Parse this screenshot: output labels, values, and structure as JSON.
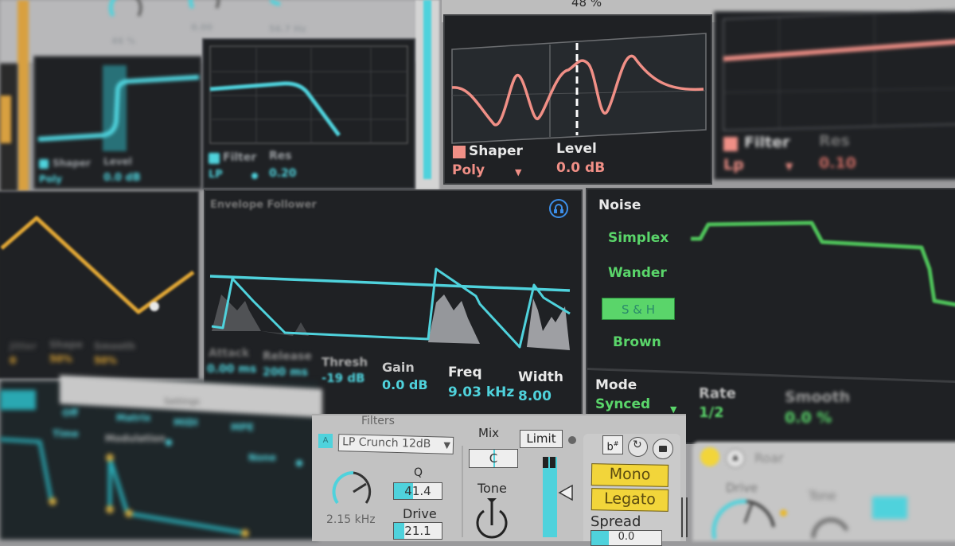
{
  "top_strip": {
    "knob_values": [
      "46 %",
      "0.00",
      "56.7 Hz"
    ],
    "right_value": "48 %"
  },
  "panel_a": {
    "shaper_toggle": "Shaper",
    "shaper_mode": "Poly",
    "level_label": "Level",
    "level_value": "0.0 dB"
  },
  "panel_a_filter": {
    "filter_label": "Filter",
    "filter_type": "LP",
    "res_label": "Res",
    "res_value": "0.20"
  },
  "shaper": {
    "toggle_label": "Shaper",
    "mode_value": "Poly",
    "level_label": "Level",
    "level_value": "0.0 dB",
    "color": "#f08f86"
  },
  "filter_b": {
    "label": "Filter",
    "type_value": "Lp",
    "res_label": "Res",
    "res_value": "0.10"
  },
  "lfo": {
    "params": [
      {
        "label": "Jitter",
        "value": "0"
      },
      {
        "label": "Shape",
        "value": "50%"
      },
      {
        "label": "Smooth",
        "value": "50%"
      }
    ],
    "color": "#e0a635"
  },
  "envelope_follower": {
    "title": "Envelope Follower",
    "params": [
      {
        "label": "Attack",
        "value": "0.00 ms"
      },
      {
        "label": "Release",
        "value": "200 ms"
      },
      {
        "label": "Thresh",
        "value": "-19 dB"
      },
      {
        "label": "Gain",
        "value": "0.0 dB"
      },
      {
        "label": "Freq",
        "value": "9.03 kHz"
      },
      {
        "label": "Width",
        "value": "8.00"
      }
    ],
    "color": "#4fd2dc"
  },
  "noise": {
    "title": "Noise",
    "types": [
      "Simplex",
      "Wander",
      "S & H",
      "Brown"
    ],
    "selected": "S & H",
    "mode_label": "Mode",
    "mode_value": "Synced",
    "rate_label": "Rate",
    "rate_value": "1/2",
    "smooth_label": "Smooth",
    "smooth_value": "0.0 %",
    "color": "#5ad56a"
  },
  "bottom_left": {
    "tabs": [
      "Settings"
    ],
    "route_buttons": [
      "Off",
      "Matrix",
      "MIDI",
      "MPE"
    ],
    "modulation_label": "Modulation",
    "none_value": "None",
    "left_values": [
      "Time"
    ]
  },
  "filters": {
    "title": "Filters",
    "filter_badge": "A",
    "filter_type": "LP Crunch 12dB",
    "freq_value": "2.15 kHz",
    "q_label": "Q",
    "q_value": "41.4",
    "drive_label": "Drive",
    "drive_value": "21.1"
  },
  "mix": {
    "title": "Mix",
    "limit_label": "Limit",
    "pan_value": "C",
    "tone_label": "Tone"
  },
  "voice": {
    "mono_label": "Mono",
    "legato_label": "Legato",
    "spread_label": "Spread",
    "spread_value": "0.0"
  },
  "roar": {
    "title": "Roar",
    "drive_label": "Drive",
    "tone_label": "Tone"
  }
}
